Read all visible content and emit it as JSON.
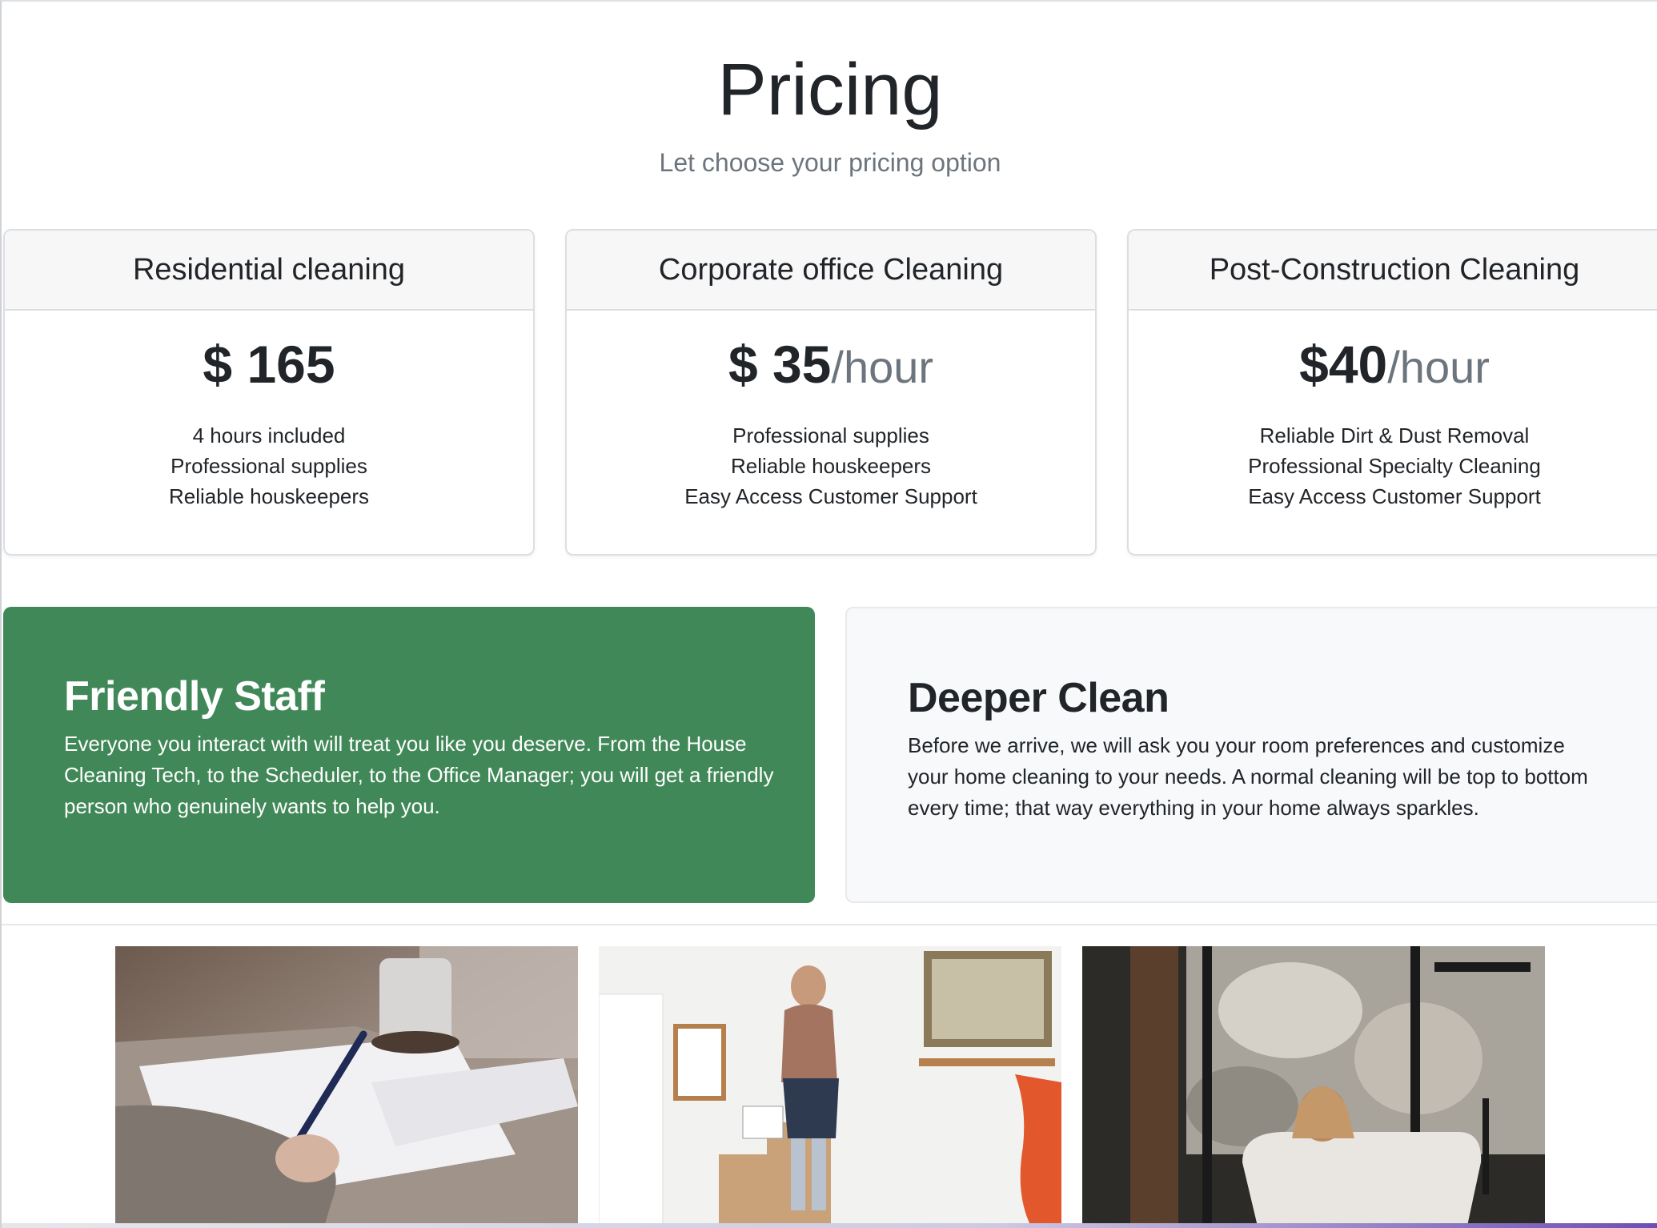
{
  "header": {
    "title": "Pricing",
    "subtitle": "Let choose your pricing option"
  },
  "plans": [
    {
      "name": "Residential cleaning",
      "price": "$ 165",
      "per": "",
      "features": [
        "4 hours included",
        "Professional supplies",
        "Reliable houskeepers"
      ]
    },
    {
      "name": "Corporate office Cleaning",
      "price": "$ 35",
      "per": "/hour",
      "features": [
        "Professional supplies",
        "Reliable houskeepers",
        "Easy Access Customer Support"
      ]
    },
    {
      "name": "Post-Construction Cleaning",
      "price": "$40",
      "per": "/hour",
      "features": [
        "Reliable Dirt & Dust Removal",
        "Professional Specialty Cleaning",
        "Easy Access Customer Support"
      ]
    }
  ],
  "features_section": {
    "friendly": {
      "title": "Friendly Staff",
      "text": "Everyone you interact with will treat you like you deserve. From the House Cleaning Tech, to the Scheduler, to the Office Manager; you will get a friendly person who genuinely wants to help you."
    },
    "deeper": {
      "title": "Deeper Clean",
      "text": "Before we arrive, we will ask you your room preferences and customize your home cleaning to your needs. A normal cleaning will be top to bottom every time; that way everything in your home always sparkles."
    }
  },
  "colors": {
    "green": "#418858",
    "muted": "#6c757d",
    "card_header": "#f7f7f7"
  }
}
